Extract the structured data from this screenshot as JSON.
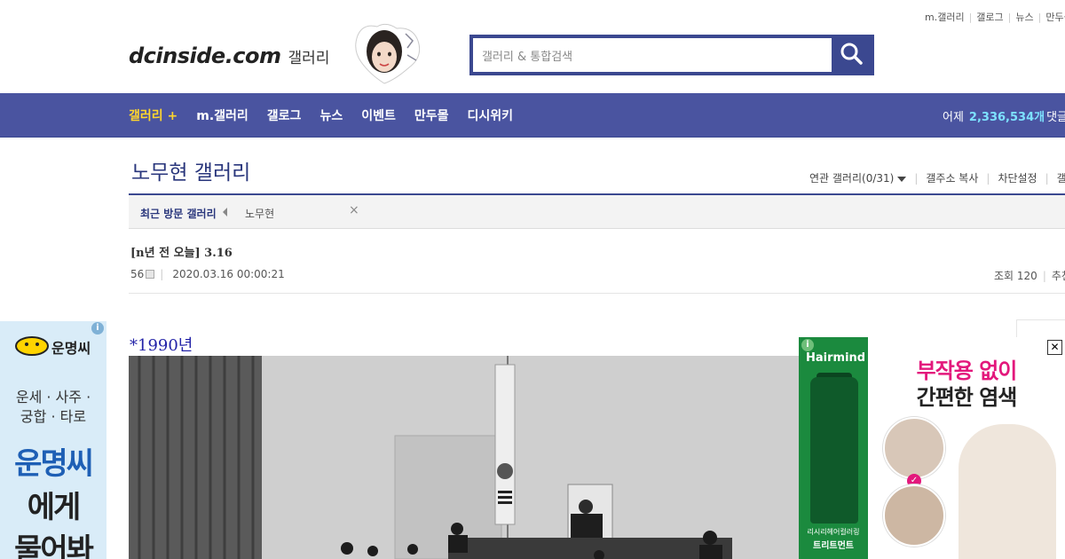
{
  "top_links": [
    "m.갤러리",
    "갤로그",
    "뉴스",
    "만두몰"
  ],
  "logo": {
    "main": "dcinside.com",
    "sub": "갤러리"
  },
  "search": {
    "placeholder": "갤러리 & 통합검색"
  },
  "nav": {
    "items": [
      "갤러리 +",
      "m.갤러리",
      "갤로그",
      "뉴스",
      "이벤트",
      "만두몰",
      "디시위키"
    ],
    "stats_label": "어제",
    "stats_value": "2,336,534개",
    "stats_suffix": "댓글"
  },
  "gallery": {
    "title": "노무현 갤러리",
    "tools": [
      "연관 갤러리(0/31)",
      "갤주소 복사",
      "차단설정",
      "갤러리"
    ]
  },
  "recent": {
    "label": "최근 방문 갤러리",
    "item": "노무현",
    "close": "×"
  },
  "post": {
    "title": "[n년 전 오늘] 3.16",
    "author": "56",
    "date": "2020.03.16 00:00:21",
    "views": "조회 120",
    "recommend": "추천"
  },
  "content": {
    "year_heading": "*1990년"
  },
  "ad_left": {
    "brand": "운명씨",
    "line1": "운세 · 사주 ·",
    "line2": "궁합 · 타로",
    "big1": "운명씨",
    "big2": "에게",
    "big3": "물어봐",
    "info": "i"
  },
  "ad_right": {
    "brand": "Hairmind",
    "headline1": "부작용 없이",
    "headline2": "간편한 염색",
    "product1": "리시리헤어컬러링",
    "product2": "트리트먼트",
    "close": "✕",
    "info": "i",
    "check": "✓",
    "brand_color": "#1b8a3e",
    "accent_color": "#e3187c"
  },
  "colors": {
    "nav_bg": "#4a54a0",
    "search_border": "#3b4890",
    "title_color": "#29367c",
    "stats_accent": "#7de1ff",
    "nav_highlight": "#ffd62d"
  }
}
